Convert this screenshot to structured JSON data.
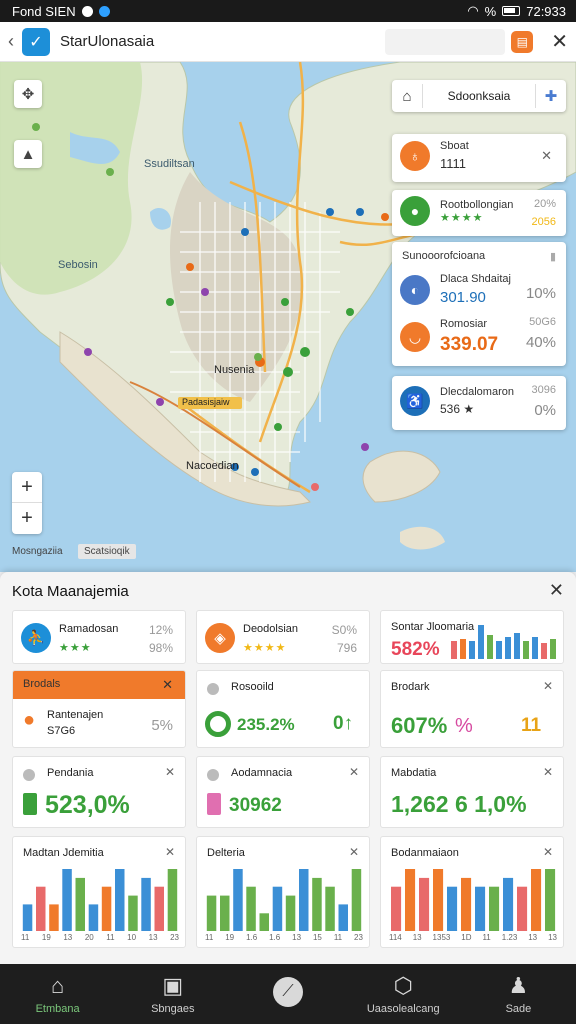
{
  "status": {
    "left": "Fond SIEN",
    "battery_pct": "%",
    "time": "72:933"
  },
  "appbar": {
    "title": "StarUlonasaia"
  },
  "map": {
    "labels": {
      "upper": "Ssudiltsan",
      "sebuah": "Sebosin",
      "lower": "Nusenia",
      "lower2": "Nacoedian",
      "pill": "Padasisjaiw"
    },
    "search_text": "Sdoonksaia",
    "scale_left": "Mosngaziia",
    "scale_right": "Scatsioqik",
    "zoom_in": "+",
    "zoom_out": "+"
  },
  "right_cards": {
    "card1": {
      "name": "Sboat",
      "value": "1111"
    },
    "card2": {
      "name": "Rootbollongian",
      "stars": "★★★★",
      "pct": "20%",
      "pct2": "2056"
    },
    "group": {
      "header": "Sunooorofcioana",
      "row1": {
        "name": "Dlaca Shdaitaj",
        "value": "301.90",
        "pct": "10%"
      },
      "row2": {
        "name": "Romosiar",
        "value": "339.07",
        "pct": "40%",
        "small": "50G6"
      }
    },
    "card4": {
      "name": "Dlecdalomaron",
      "value": "536 ★",
      "pct": "0%",
      "small": "3096"
    }
  },
  "panel": {
    "title": "Kota Maanajemia",
    "cards": {
      "a1": {
        "title": "Ramadosan",
        "stars": "★★★",
        "pct1": "12%",
        "pct2": "98%"
      },
      "a2": {
        "title": "Deodolsian",
        "stars": "★★★★",
        "pct1": "S0%",
        "pct2": "796"
      },
      "a3": {
        "title": "Sontar Jloomaria",
        "value": "582%"
      },
      "b1": {
        "header": "Brodals",
        "title": "Rantenajen",
        "sub": "S7G6",
        "pct": "5%"
      },
      "b2": {
        "title": "Rosooild",
        "value": "235.2%",
        "value2": "0↑"
      },
      "b3": {
        "title": "Brodark",
        "value": "607%",
        "value2": "11"
      },
      "c1": {
        "title": "Pendania",
        "value": "523,0%"
      },
      "c2": {
        "title": "Aodamnacia",
        "value": "30962"
      },
      "c3": {
        "title": "Mabdatia",
        "value": "1,262 6 1,0%"
      },
      "d1": {
        "title": "Madtan Jdemitia",
        "ticks": [
          "11",
          "19",
          "13",
          "20",
          "11",
          "10",
          "13",
          "23"
        ]
      },
      "d2": {
        "title": "Delteria",
        "ticks": [
          "11",
          "19",
          "1.6",
          "1.6",
          "13",
          "15",
          "11",
          "23"
        ]
      },
      "d3": {
        "title": "Bodanmaiaon",
        "ticks": [
          "114",
          "13",
          "1353",
          "1D",
          "11",
          "1.23",
          "13",
          "13"
        ]
      }
    }
  },
  "chart_data": [
    {
      "type": "bar",
      "categories": [
        "1",
        "2",
        "3",
        "4",
        "5",
        "6",
        "7",
        "8",
        "9",
        "10",
        "11",
        "12"
      ],
      "values": [
        3,
        5,
        3,
        7,
        6,
        3,
        5,
        7,
        4,
        6,
        5,
        7
      ],
      "colors": [
        "#3b8fd6",
        "#e86a6a",
        "#f07a2b",
        "#3b8fd6",
        "#6ab04c",
        "#3b8fd6",
        "#f07a2b",
        "#3b8fd6",
        "#6ab04c",
        "#3b8fd6",
        "#e86a6a",
        "#6ab04c"
      ]
    },
    {
      "type": "bar",
      "categories": [
        "1",
        "2",
        "3",
        "4",
        "5",
        "6",
        "7",
        "8",
        "9",
        "10",
        "11",
        "12"
      ],
      "values": [
        4,
        2,
        5,
        3,
        8,
        3,
        6,
        4,
        5,
        3,
        8,
        6
      ],
      "colors": [
        "#f07a2b",
        "#3b8fd6",
        "#f07a2b",
        "#3b8fd6",
        "#3b8fd6",
        "#e86a6a",
        "#f07a2b",
        "#3b8fd6",
        "#6ab04c",
        "#3b8fd6",
        "#6ab04c",
        "#6ab04c"
      ]
    },
    {
      "type": "bar",
      "categories": [
        "1",
        "2",
        "3",
        "4",
        "5",
        "6",
        "7",
        "8",
        "9",
        "10",
        "11",
        "12"
      ],
      "values": [
        4,
        4,
        7,
        5,
        2,
        5,
        4,
        7,
        6,
        5,
        3,
        7
      ],
      "colors": [
        "#6ab04c",
        "#6ab04c",
        "#3b8fd6",
        "#6ab04c",
        "#6ab04c",
        "#3b8fd6",
        "#6ab04c",
        "#3b8fd6",
        "#6ab04c",
        "#6ab04c",
        "#3b8fd6",
        "#6ab04c"
      ]
    },
    {
      "type": "bar",
      "categories": [
        "1",
        "2",
        "3",
        "4",
        "5",
        "6",
        "7",
        "8",
        "9",
        "10",
        "11",
        "12"
      ],
      "values": [
        5,
        7,
        6,
        7,
        5,
        6,
        5,
        5,
        6,
        5,
        7,
        7
      ],
      "colors": [
        "#e86a6a",
        "#f07a2b",
        "#e86a6a",
        "#f07a2b",
        "#3b8fd6",
        "#f07a2b",
        "#3b8fd6",
        "#6ab04c",
        "#3b8fd6",
        "#e86a6a",
        "#f07a2b",
        "#6ab04c"
      ]
    }
  ],
  "nav": [
    {
      "label": "Etmbana",
      "icon": "home-icon",
      "green": true
    },
    {
      "label": "Sbngaes",
      "icon": "window-icon"
    },
    {
      "label": "",
      "icon": "compose-icon",
      "active": true
    },
    {
      "label": "Uaasolealcang",
      "icon": "shield-icon"
    },
    {
      "label": "Sade",
      "icon": "person-icon"
    }
  ]
}
